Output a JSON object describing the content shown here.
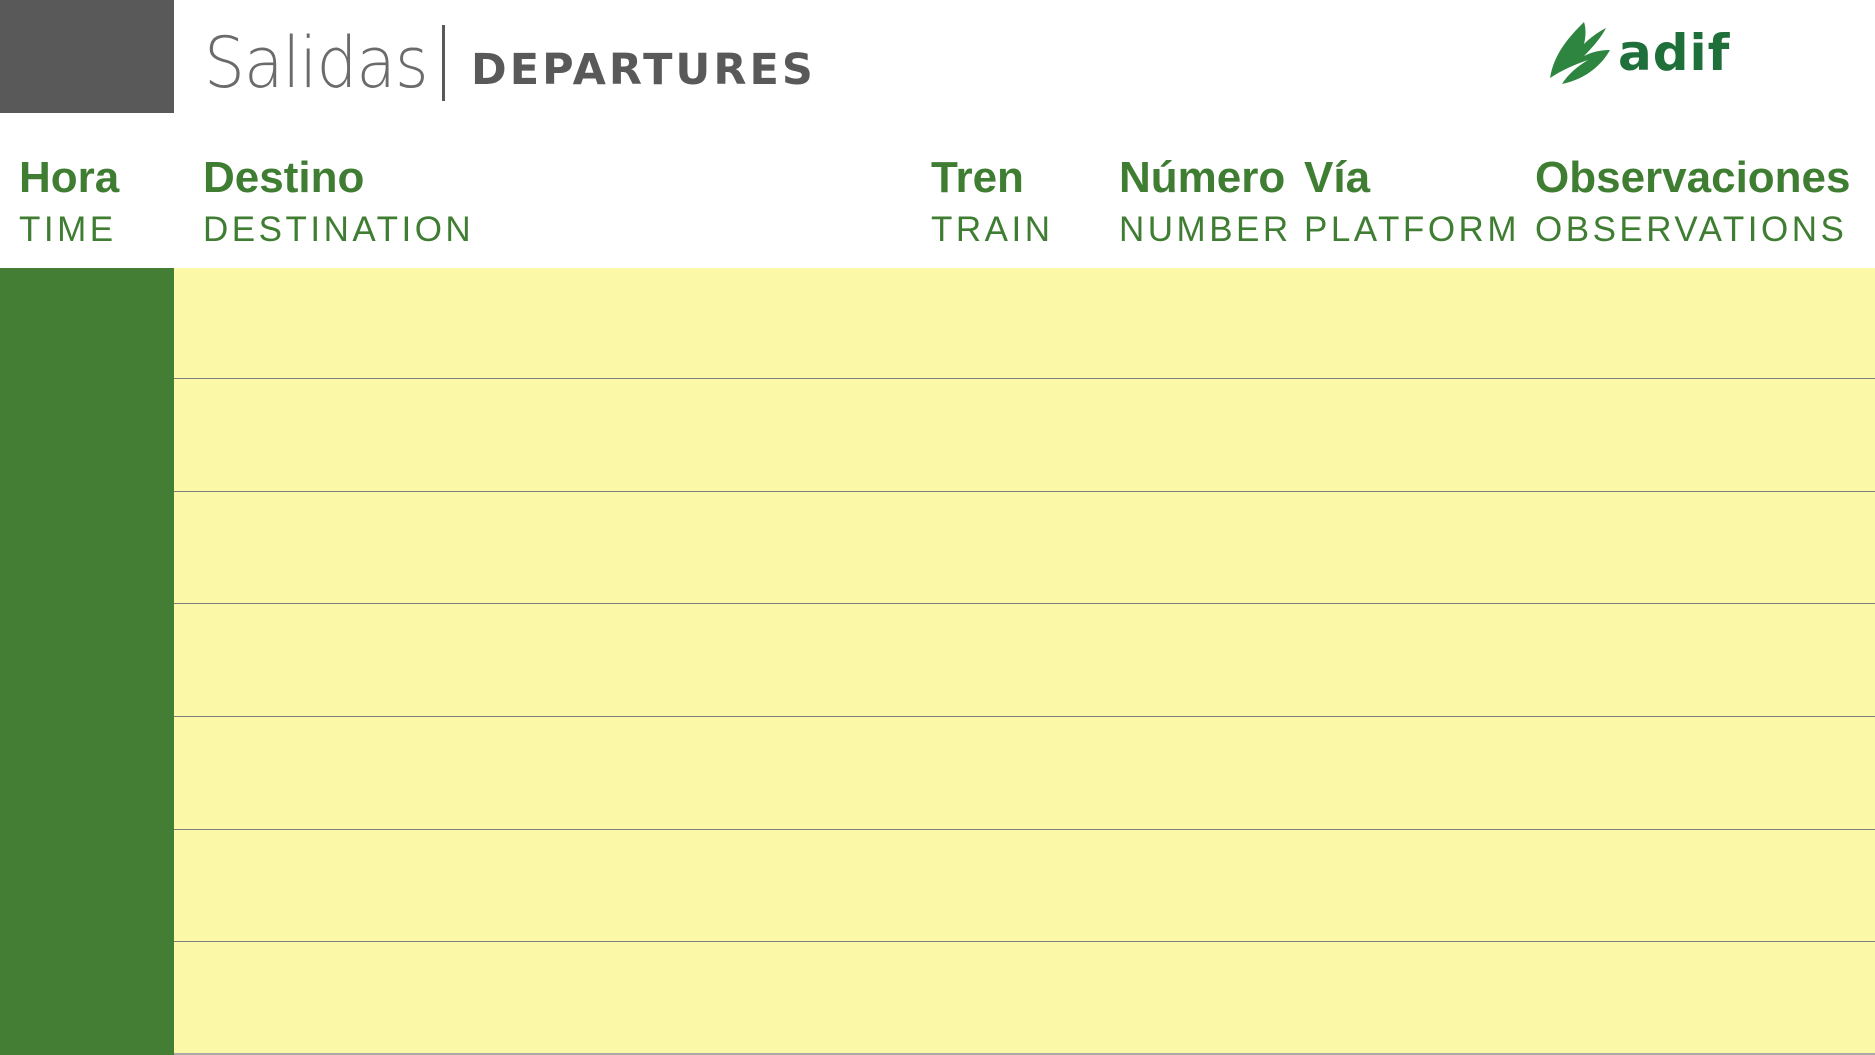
{
  "header": {
    "title_es": "Salidas",
    "title_en": "DEPARTURES",
    "logo_text": "adif"
  },
  "columns": [
    {
      "key": "hora",
      "label_es": "Hora",
      "label_en": "TIME"
    },
    {
      "key": "destino",
      "label_es": "Destino",
      "label_en": "DESTINATION"
    },
    {
      "key": "tren",
      "label_es": "Tren",
      "label_en": "TRAIN"
    },
    {
      "key": "numero",
      "label_es": "Número",
      "label_en": "NUMBER"
    },
    {
      "key": "via",
      "label_es": "Vía",
      "label_en": "PLATFORM"
    },
    {
      "key": "observaciones",
      "label_es": "Observaciones",
      "label_en": "OBSERVATIONS"
    }
  ],
  "colors": {
    "accent_green": "#3f7e32",
    "side_green": "#437e34",
    "row_background": "#fbf9a8",
    "corner_gray": "#595959",
    "logo_green": "#1f6f3a"
  }
}
